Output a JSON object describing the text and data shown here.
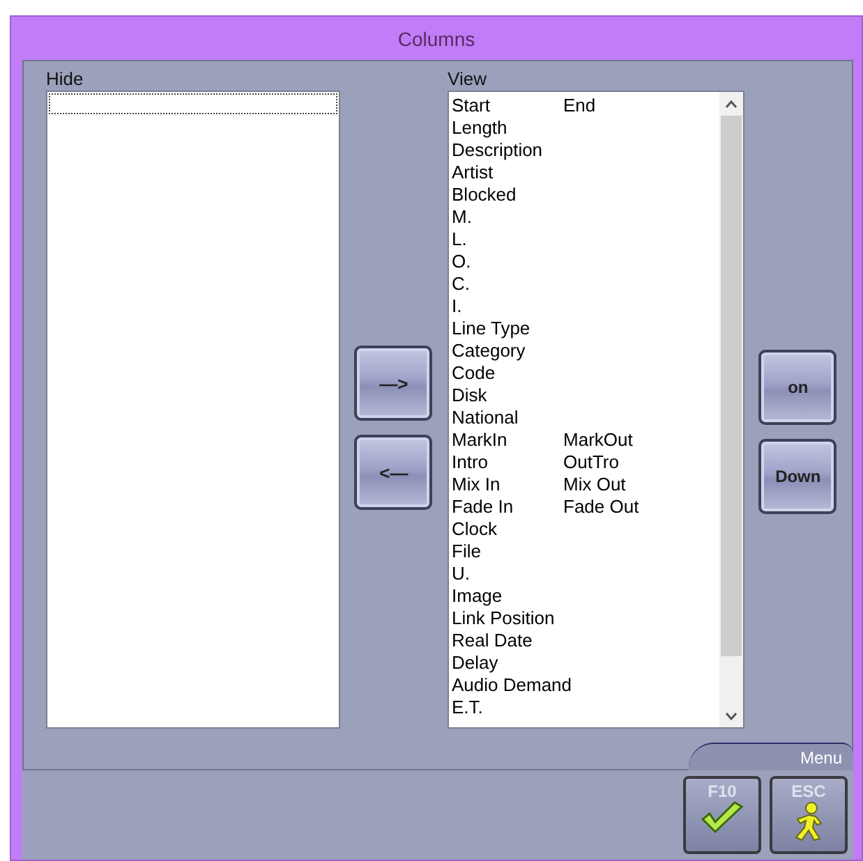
{
  "window": {
    "title": "Columns"
  },
  "hide_list": {
    "label": "Hide"
  },
  "view_list": {
    "label": "View",
    "items": [
      {
        "text": "Start",
        "text_2": "End"
      },
      {
        "text": "Length"
      },
      {
        "text": "Description"
      },
      {
        "text": "Artist"
      },
      {
        "text": "Blocked"
      },
      {
        "text": "M."
      },
      {
        "text": "L."
      },
      {
        "text": "O."
      },
      {
        "text": "C."
      },
      {
        "text": "I."
      },
      {
        "text": "Line Type"
      },
      {
        "text": "Category"
      },
      {
        "text": "Code"
      },
      {
        "text": "Disk"
      },
      {
        "text": "National"
      },
      {
        "text": "MarkIn",
        "text_2": "MarkOut"
      },
      {
        "text": "Intro",
        "text_2": "OutTro"
      },
      {
        "text": "Mix In",
        "text_2": "Mix Out"
      },
      {
        "text": "Fade In",
        "text_2": "Fade Out"
      },
      {
        "text": "Clock"
      },
      {
        "text": "File"
      },
      {
        "text": "U."
      },
      {
        "text": "Image"
      },
      {
        "text": "Link Position"
      },
      {
        "text": "Real Date"
      },
      {
        "text": "Delay"
      },
      {
        "text": "Audio Demand"
      },
      {
        "text": "E.T."
      }
    ]
  },
  "move_buttons": [
    {
      "label": "—>"
    },
    {
      "label": "<—"
    }
  ],
  "order_buttons": [
    {
      "label": "on"
    },
    {
      "label": "Down"
    }
  ],
  "menu": {
    "label": "Menu",
    "buttons": [
      {
        "key": "F10",
        "kind": "ok"
      },
      {
        "key": "ESC",
        "kind": "exit"
      }
    ]
  }
}
